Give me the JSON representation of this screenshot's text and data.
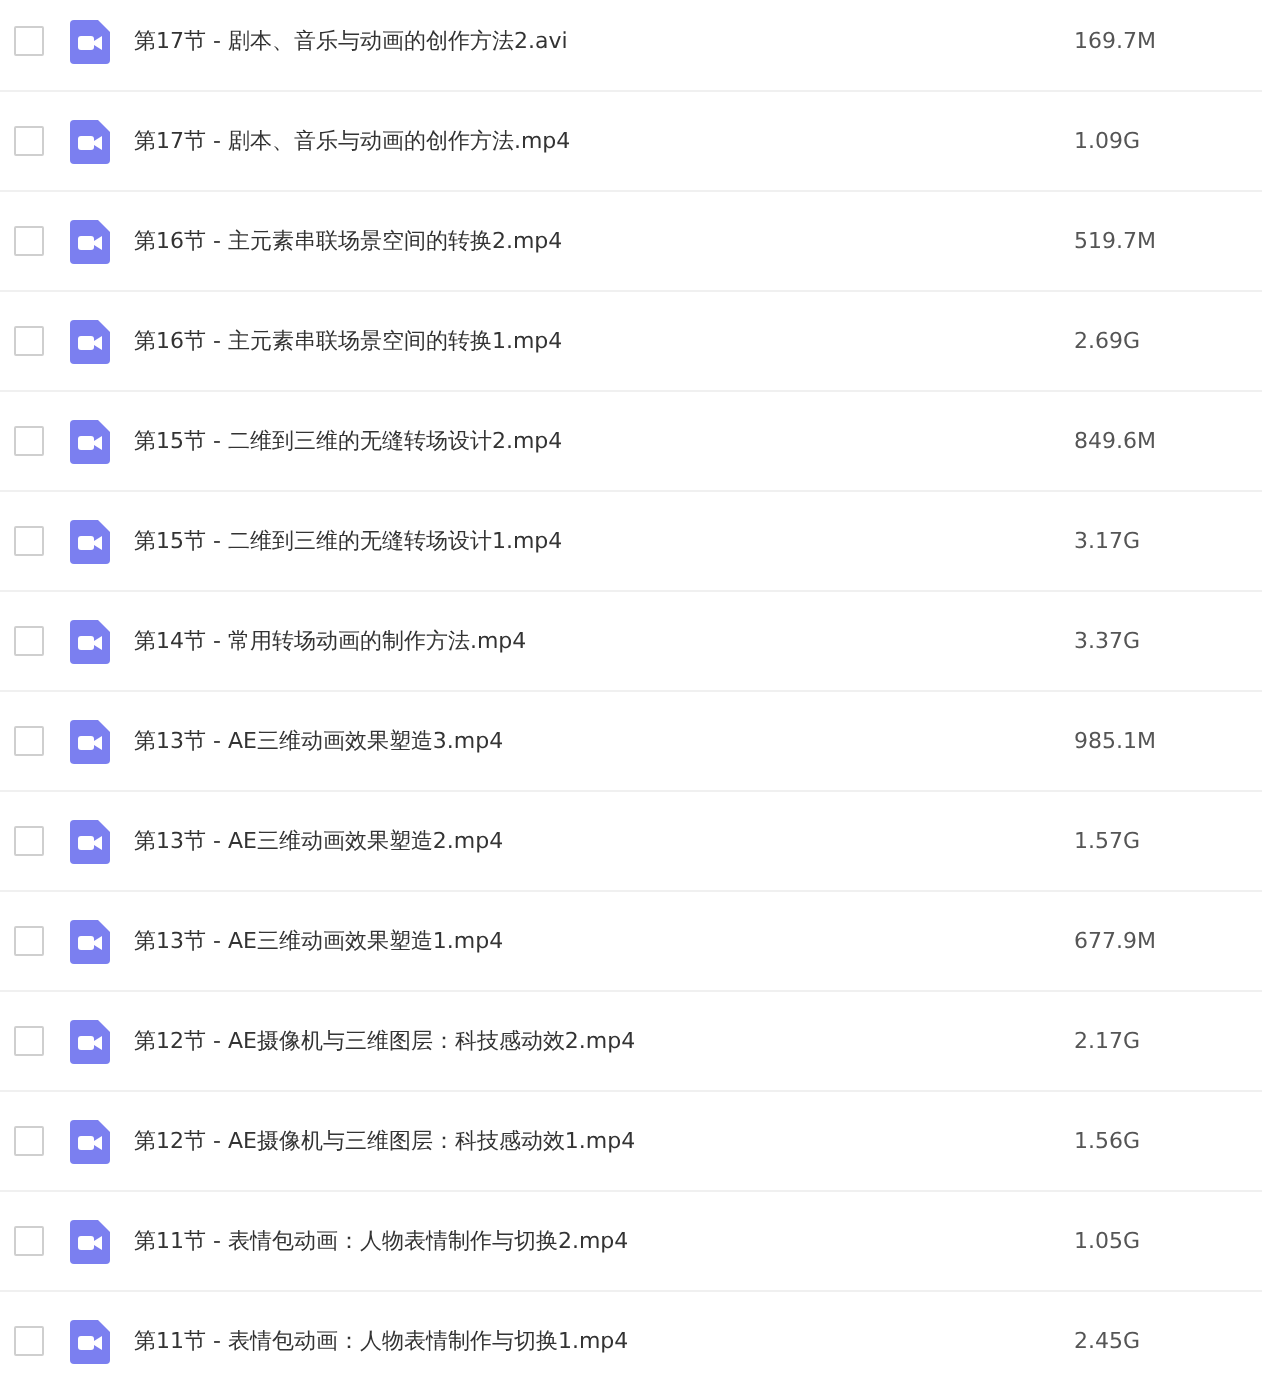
{
  "files": [
    {
      "name": "第17节 - 剧本、音乐与动画的创作方法2.avi",
      "size": "169.7M",
      "checked": false
    },
    {
      "name": "第17节 - 剧本、音乐与动画的创作方法.mp4",
      "size": "1.09G",
      "checked": false
    },
    {
      "name": "第16节 - 主元素串联场景空间的转换2.mp4",
      "size": "519.7M",
      "checked": false
    },
    {
      "name": "第16节 - 主元素串联场景空间的转换1.mp4",
      "size": "2.69G",
      "checked": false
    },
    {
      "name": "第15节 - 二维到三维的无缝转场设计2.mp4",
      "size": "849.6M",
      "checked": false
    },
    {
      "name": "第15节 - 二维到三维的无缝转场设计1.mp4",
      "size": "3.17G",
      "checked": false
    },
    {
      "name": "第14节 - 常用转场动画的制作方法.mp4",
      "size": "3.37G",
      "checked": false
    },
    {
      "name": "第13节 - AE三维动画效果塑造3.mp4",
      "size": "985.1M",
      "checked": false
    },
    {
      "name": "第13节 - AE三维动画效果塑造2.mp4",
      "size": "1.57G",
      "checked": false
    },
    {
      "name": "第13节 - AE三维动画效果塑造1.mp4",
      "size": "677.9M",
      "checked": false
    },
    {
      "name": "第12节 - AE摄像机与三维图层：科技感动效2.mp4",
      "size": "2.17G",
      "checked": false
    },
    {
      "name": "第12节 - AE摄像机与三维图层：科技感动效1.mp4",
      "size": "1.56G",
      "checked": false
    },
    {
      "name": "第11节 - 表情包动画：人物表情制作与切换2.mp4",
      "size": "1.05G",
      "checked": false
    },
    {
      "name": "第11节 - 表情包动画：人物表情制作与切换1.mp4",
      "size": "2.45G",
      "checked": false
    }
  ]
}
